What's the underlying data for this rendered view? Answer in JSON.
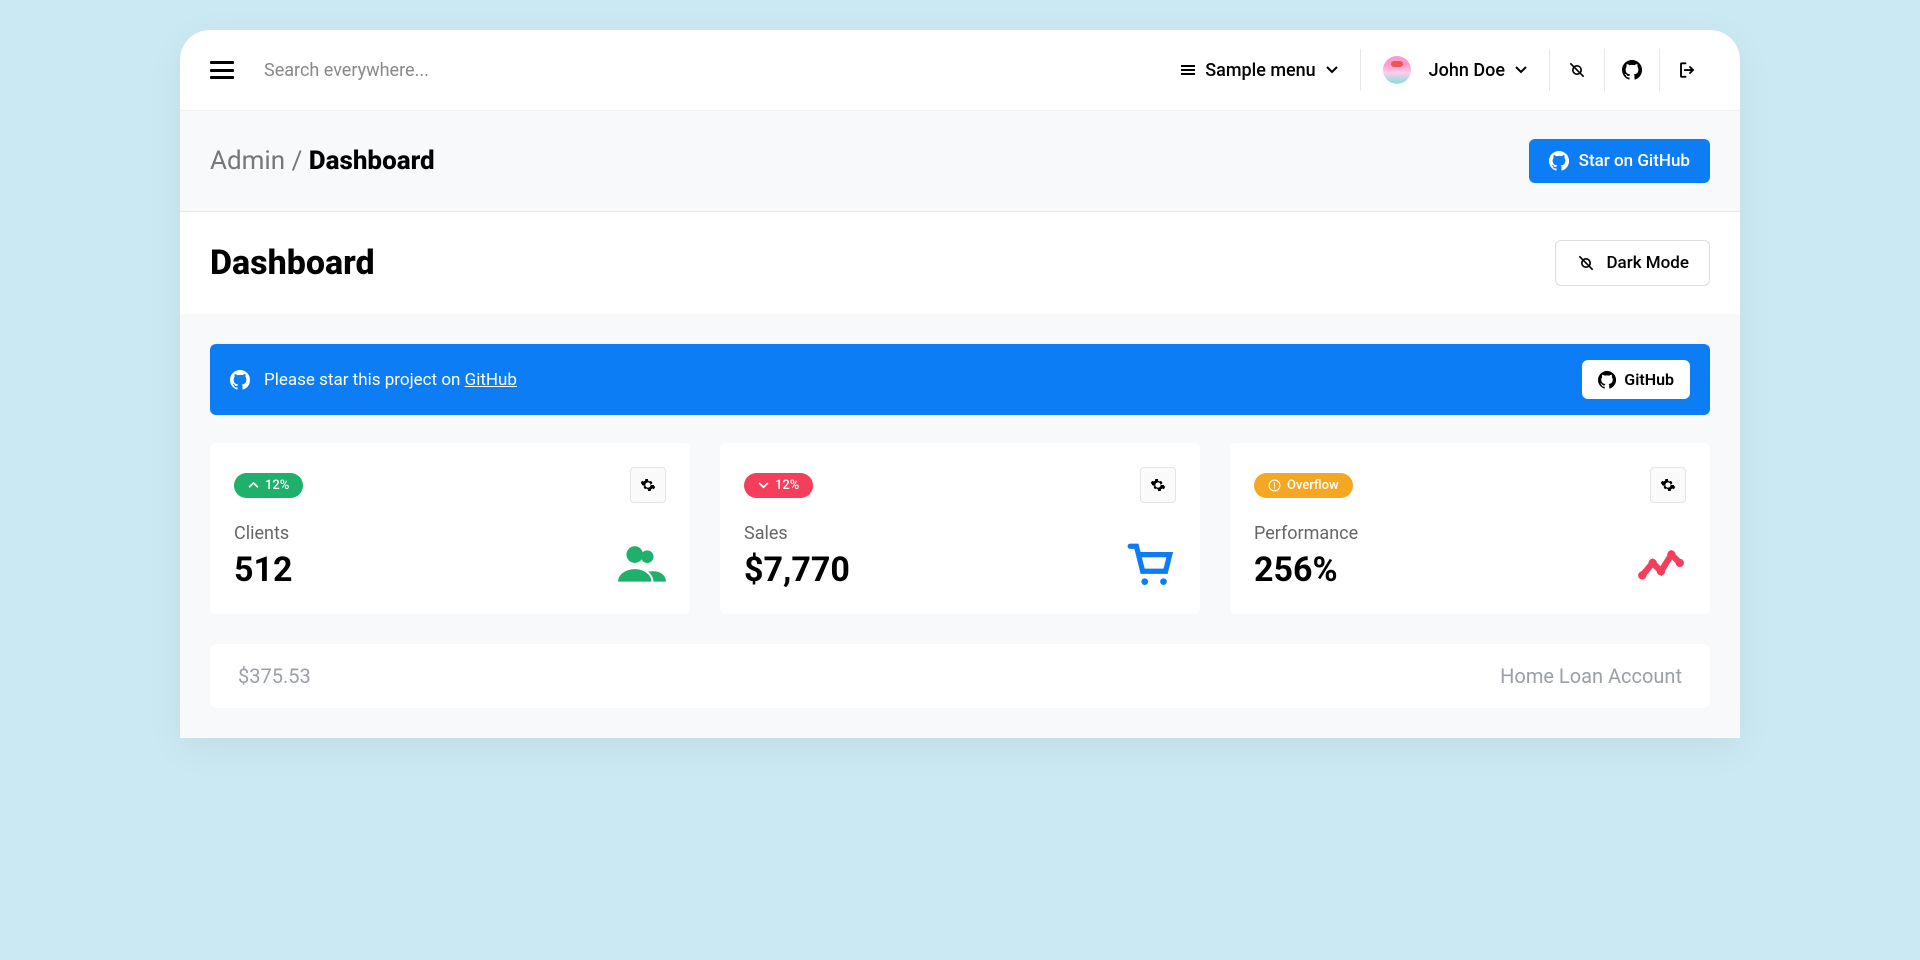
{
  "topbar": {
    "search_placeholder": "Search everywhere...",
    "sample_menu": "Sample menu",
    "user_name": "John Doe"
  },
  "header": {
    "breadcrumb_parent": "Admin",
    "breadcrumb_sep": "/",
    "breadcrumb_current": "Dashboard",
    "star_button": "Star on GitHub"
  },
  "title": {
    "page_title": "Dashboard",
    "dark_mode": "Dark Mode"
  },
  "banner": {
    "text": "Please star this project on ",
    "link": "GitHub",
    "button": "GitHub"
  },
  "cards": [
    {
      "badge": "12%",
      "label": "Clients",
      "value": "512"
    },
    {
      "badge": "12%",
      "label": "Sales",
      "value": "$7,770"
    },
    {
      "badge": "Overflow",
      "label": "Performance",
      "value": "256%"
    }
  ],
  "table": {
    "amount": "$375.53",
    "account": "Home Loan Account"
  }
}
